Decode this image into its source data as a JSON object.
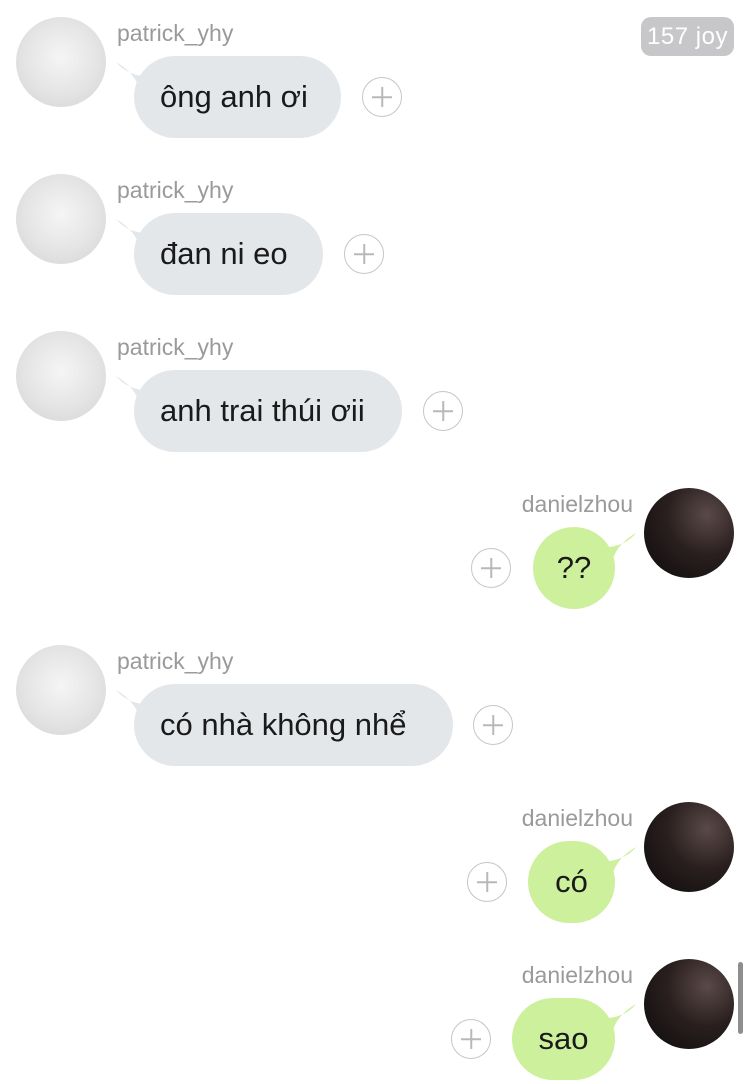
{
  "badge": "157 joy",
  "messages": [
    {
      "sender": "patrick_yhy",
      "text": "ông anh ơi",
      "avatar": "patrick-avatar"
    },
    {
      "sender": "patrick_yhy",
      "text": "đan ni eo",
      "avatar": "patrick-avatar"
    },
    {
      "sender": "patrick_yhy",
      "text": "anh trai thúi ơii",
      "avatar": "patrick-avatar"
    },
    {
      "sender": "danielzhou",
      "text": "??",
      "avatar": "daniel-avatar"
    },
    {
      "sender": "patrick_yhy",
      "text": "có nhà không nhể",
      "avatar": "patrick-avatar"
    },
    {
      "sender": "danielzhou",
      "text": "có",
      "avatar": "daniel-avatar"
    },
    {
      "sender": "danielzhou",
      "text": "sao",
      "avatar": "daniel-avatar"
    }
  ],
  "colors": {
    "incoming_bubble": "#e4e7ea",
    "outgoing_bubble": "#cdf09d",
    "sender_text": "#9a9a9a",
    "badge_bg": "#c7c7c9"
  }
}
